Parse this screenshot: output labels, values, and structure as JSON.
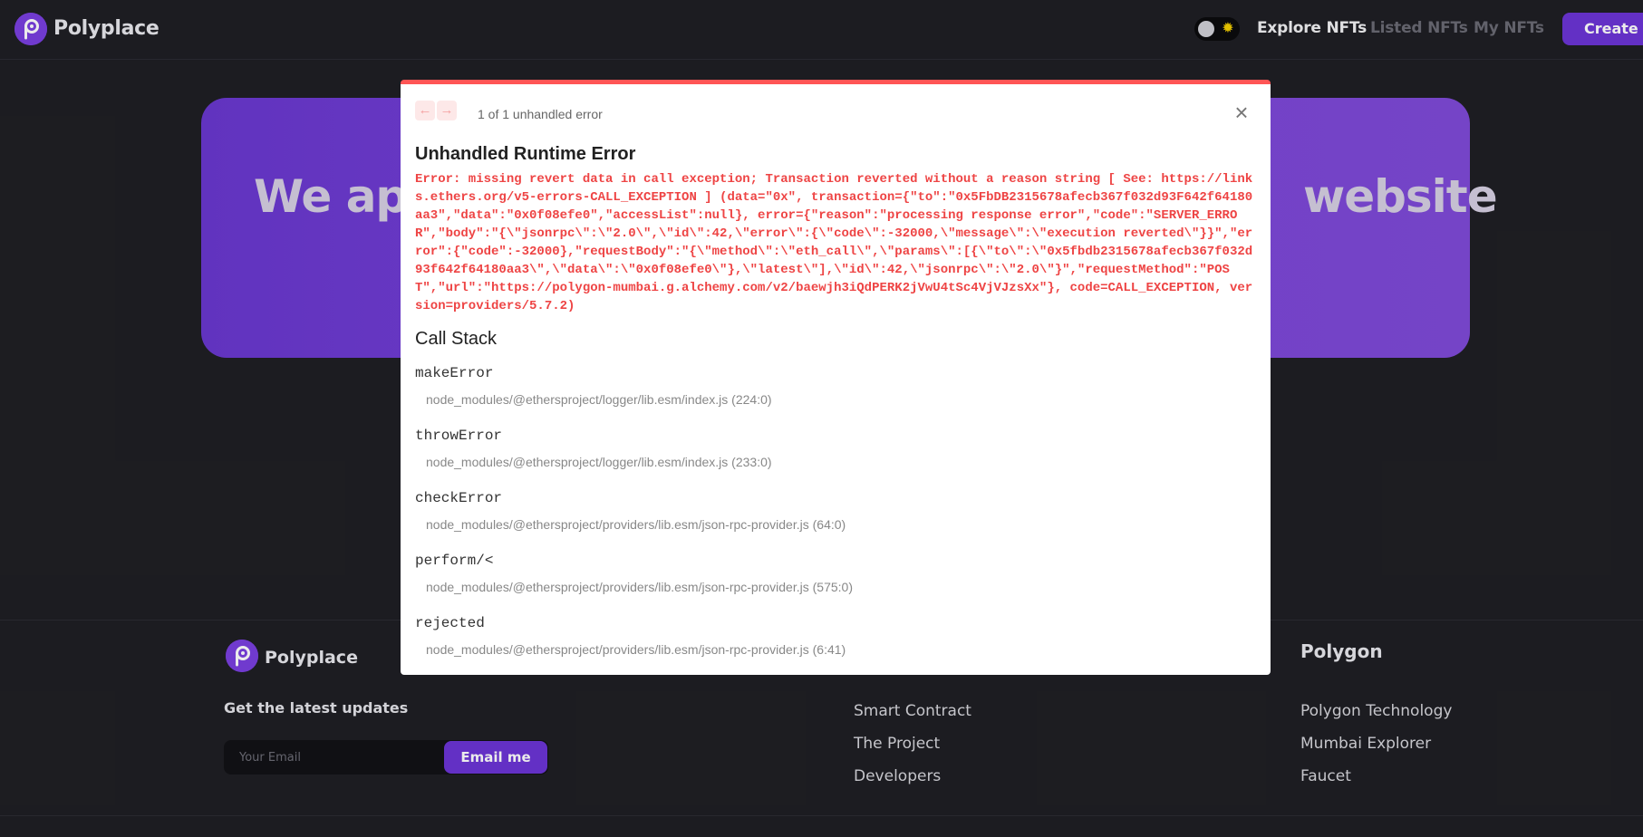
{
  "navbar": {
    "brand": "Polyplace",
    "theme_toggle_icon": "sun-icon",
    "links": [
      {
        "label": "Explore NFTs",
        "active": true
      },
      {
        "label": "Listed NFTs",
        "active": false
      },
      {
        "label": "My NFTs",
        "active": false
      }
    ],
    "create_label": "Create"
  },
  "hero": {
    "title_left": "We ape",
    "title_right": "website"
  },
  "footer": {
    "brand": "Polyplace",
    "updates_heading": "Get the latest updates",
    "email_placeholder": "Your Email",
    "email_button": "Email me",
    "col2_links": [
      "Smart Contract",
      "The Project",
      "Developers"
    ],
    "col3_heading": "Polygon",
    "col3_links": [
      "Polygon Technology",
      "Mumbai Explorer",
      "Faucet"
    ]
  },
  "error_overlay": {
    "count_label": "1 of 1 unhandled error",
    "title": "Unhandled Runtime Error",
    "message": "Error: missing revert data in call exception; Transaction reverted without a reason string [ See: https://links.ethers.org/v5-errors-CALL_EXCEPTION ] (data=\"0x\", transaction={\"to\":\"0x5FbDB2315678afecb367f032d93F642f64180aa3\",\"data\":\"0x0f08efe0\",\"accessList\":null}, error={\"reason\":\"processing response error\",\"code\":\"SERVER_ERROR\",\"body\":\"{\\\"jsonrpc\\\":\\\"2.0\\\",\\\"id\\\":42,\\\"error\\\":{\\\"code\\\":-32000,\\\"message\\\":\\\"execution reverted\\\"}}\",\"error\":{\"code\":-32000},\"requestBody\":\"{\\\"method\\\":\\\"eth_call\\\",\\\"params\\\":[{\\\"to\\\":\\\"0x5fbdb2315678afecb367f032d93f642f64180aa3\\\",\\\"data\\\":\\\"0x0f08efe0\\\"},\\\"latest\\\"],\\\"id\\\":42,\\\"jsonrpc\\\":\\\"2.0\\\"}\",\"requestMethod\":\"POST\",\"url\":\"https://polygon-mumbai.g.alchemy.com/v2/baewjh3iQdPERK2jVwU4tSc4VjVJzsXx\"}, code=CALL_EXCEPTION, version=providers/5.7.2)",
    "call_stack_title": "Call Stack",
    "frames": [
      {
        "fn": "makeError",
        "loc": "node_modules/@ethersproject/logger/lib.esm/index.js (224:0)"
      },
      {
        "fn": "throwError",
        "loc": "node_modules/@ethersproject/logger/lib.esm/index.js (233:0)"
      },
      {
        "fn": "checkError",
        "loc": "node_modules/@ethersproject/providers/lib.esm/json-rpc-provider.js (64:0)"
      },
      {
        "fn": "perform/<",
        "loc": "node_modules/@ethersproject/providers/lib.esm/json-rpc-provider.js (575:0)"
      },
      {
        "fn": "rejected",
        "loc": "node_modules/@ethersproject/providers/lib.esm/json-rpc-provider.js (6:41)"
      }
    ]
  },
  "colors": {
    "accent": "#6c35d6",
    "error_red": "#ee4444",
    "background": "#1f1f24"
  }
}
